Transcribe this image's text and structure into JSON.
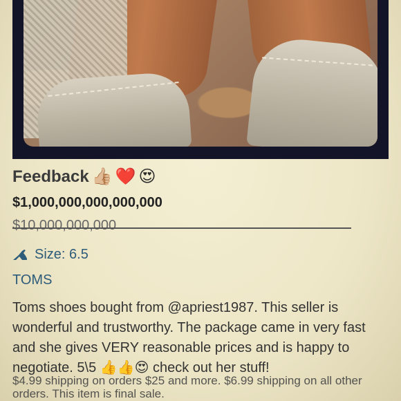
{
  "listing": {
    "title": "Feedback",
    "title_emojis": [
      "👍🏼",
      "❤️",
      "😍"
    ],
    "price": "$1,000,000,000,000,000",
    "original_price": "$10,000,000,000",
    "size_label": "Size: 6.5",
    "brand": "TOMS",
    "description": "Toms shoes bought from @apriest1987. This seller is wonderful and trustworthy. The package came in very fast and she gives VERY reasonable prices and is happy to negotiate. 5\\5 👍👍😍 check out her stuff!",
    "shipping_note": "$4.99 shipping on orders $25 and more. $6.99 shipping on all other orders. This item is final sale."
  },
  "colors": {
    "link_blue": "#2d5b7a",
    "frame_navy": "#141428",
    "background_cream": "#efe9cb"
  },
  "icons": {
    "size": "heel-shoe-icon"
  }
}
